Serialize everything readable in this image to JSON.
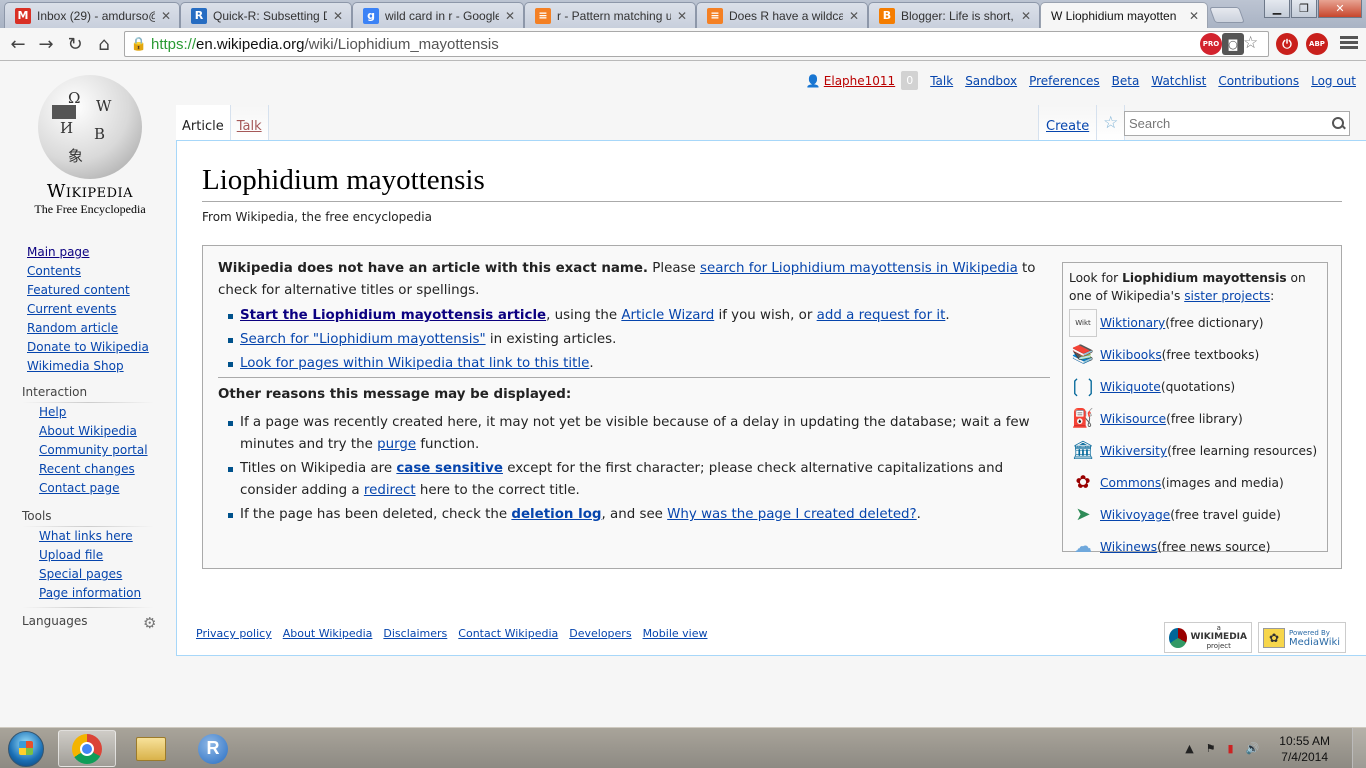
{
  "browser": {
    "tabs": [
      {
        "title": "Inbox (29) - amdurso@",
        "icon": "gmail-icon",
        "icon_text": "M",
        "icon_color": "#d93025"
      },
      {
        "title": "Quick-R: Subsetting Da",
        "icon": "r-project-icon",
        "icon_text": "R",
        "icon_color": "#276dc2"
      },
      {
        "title": "wild card in r - Google",
        "icon": "google-icon",
        "icon_text": "g",
        "icon_color": "#3b82f6"
      },
      {
        "title": "r - Pattern matching u",
        "icon": "stackoverflow-icon",
        "icon_text": "≡",
        "icon_color": "#f48024"
      },
      {
        "title": "Does R have a wildcard",
        "icon": "stackoverflow-icon",
        "icon_text": "≡",
        "icon_color": "#f48024"
      },
      {
        "title": "Blogger: Life is short, i",
        "icon": "blogger-icon",
        "icon_text": "B",
        "icon_color": "#f57d00"
      },
      {
        "title": "W Liophidium mayotten",
        "icon": "wikipedia-icon",
        "icon_text": "",
        "icon_color": "#ffffff"
      }
    ],
    "url_scheme": "https://",
    "url_host": "en.wikipedia.org",
    "url_path": "/wiki/Liophidium_mayottensis",
    "ext_pro": "PRO",
    "ext_abp": "ABP"
  },
  "logo": {
    "wordmark": "Wikipedia",
    "tagline": "The Free Encyclopedia"
  },
  "personal": {
    "username": "Elaphe1011",
    "notifications": "0",
    "links": [
      "Talk",
      "Sandbox",
      "Preferences",
      "Beta",
      "Watchlist",
      "Contributions",
      "Log out"
    ]
  },
  "page_tabs": {
    "article": "Article",
    "talk": "Talk",
    "create": "Create"
  },
  "search": {
    "placeholder": "Search"
  },
  "article": {
    "title": "Liophidium mayottensis",
    "from": "From Wikipedia, the free encyclopedia",
    "notice_bold": "Wikipedia does not have an article with this exact name.",
    "notice_please": " Please ",
    "notice_search_link": "search for Liophidium mayottensis in Wikipedia",
    "notice_rest": " to check for alternative titles or spellings.",
    "item1_link": "Start the Liophidium mayottensis article",
    "item1_mid": ", using the ",
    "item1_wizard": "Article Wizard",
    "item1_mid2": " if you wish, or ",
    "item1_request": "add a request for it",
    "item1_end": ".",
    "item2_link": "Search for \"Liophidium mayottensis\"",
    "item2_rest": " in existing articles.",
    "item3_link": "Look for pages within Wikipedia that link to this title",
    "item3_end": ".",
    "other_heading": "Other reasons this message may be displayed:",
    "reason1_a": "If a page was recently created here, it may not yet be visible because of a delay in updating the database; wait a few minutes and try the ",
    "reason1_link": "purge",
    "reason1_b": " function.",
    "reason2_a": "Titles on Wikipedia are ",
    "reason2_link": "case sensitive",
    "reason2_b": " except for the first character; please check alternative capitalizations and consider adding a ",
    "reason2_link2": "redirect",
    "reason2_c": " here to the correct title.",
    "reason3_a": "If the page has been deleted, check the ",
    "reason3_link": "deletion log",
    "reason3_b": ", and see ",
    "reason3_link2": "Why was the page I created deleted?",
    "reason3_c": "."
  },
  "sister": {
    "intro_a": "Look for ",
    "intro_bold": "Liophidium mayottensis",
    "intro_b": " on one of Wikipedia's ",
    "intro_link": "sister projects",
    "intro_c": ":",
    "projects": [
      {
        "name": "Wiktionary",
        "desc": " (free dictionary)",
        "icon": "wiktionary-icon"
      },
      {
        "name": "Wikibooks",
        "desc": " (free textbooks)",
        "icon": "wikibooks-icon"
      },
      {
        "name": "Wikiquote",
        "desc": " (quotations)",
        "icon": "wikiquote-icon"
      },
      {
        "name": "Wikisource",
        "desc": " (free library)",
        "icon": "wikisource-icon"
      },
      {
        "name": "Wikiversity",
        "desc": " (free learning resources)",
        "icon": "wikiversity-icon"
      },
      {
        "name": "Commons",
        "desc": " (images and media)",
        "icon": "commons-icon"
      },
      {
        "name": "Wikivoyage",
        "desc": " (free travel guide)",
        "icon": "wikivoyage-icon"
      },
      {
        "name": "Wikinews",
        "desc": " (free news source)",
        "icon": "wikinews-icon"
      }
    ]
  },
  "sidebar": {
    "navigation": [
      "Main page",
      "Contents",
      "Featured content",
      "Current events",
      "Random article",
      "Donate to Wikipedia",
      "Wikimedia Shop"
    ],
    "interaction_heading": "Interaction",
    "interaction": [
      "Help",
      "About Wikipedia",
      "Community portal",
      "Recent changes",
      "Contact page"
    ],
    "tools_heading": "Tools",
    "tools": [
      "What links here",
      "Upload file",
      "Special pages",
      "Page information"
    ],
    "languages_heading": "Languages"
  },
  "footer": {
    "links": [
      "Privacy policy",
      "About Wikipedia",
      "Disclaimers",
      "Contact Wikipedia",
      "Developers",
      "Mobile view"
    ],
    "badge1_small": "a",
    "badge1": "WIKIMEDIA",
    "badge1_sub": "project",
    "badge2_small": "Powered By",
    "badge2": "MediaWiki"
  },
  "taskbar": {
    "time": "10:55 AM",
    "date": "7/4/2014"
  }
}
